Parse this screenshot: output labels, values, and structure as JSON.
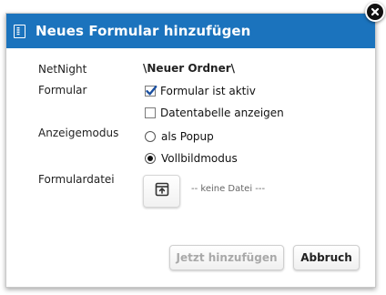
{
  "dialog": {
    "title": "Neues Formular hinzufügen",
    "icons": {
      "title": "form-document-icon",
      "close": "close-icon",
      "upload": "upload-icon"
    },
    "colors": {
      "titlebar": "#1b73bd"
    }
  },
  "fields": {
    "netnight_label": "NetNight",
    "netnight_value": "\\Neuer Ordner\\",
    "formular_label": "Formular",
    "formular_active_label": "Formular ist aktiv",
    "formular_active_checked": true,
    "datatable_label": "Datentabelle anzeigen",
    "datatable_checked": false,
    "anzeigemodus_label": "Anzeigemodus",
    "popup_label": "als Popup",
    "fullscreen_label": "Vollbildmodus",
    "selected_mode": "Vollbildmodus",
    "formulardatei_label": "Formulardatei",
    "no_file_text": "-- keine Datei ---"
  },
  "buttons": {
    "add_label": "Jetzt hinzufügen",
    "add_enabled": false,
    "cancel_label": "Abbruch"
  }
}
